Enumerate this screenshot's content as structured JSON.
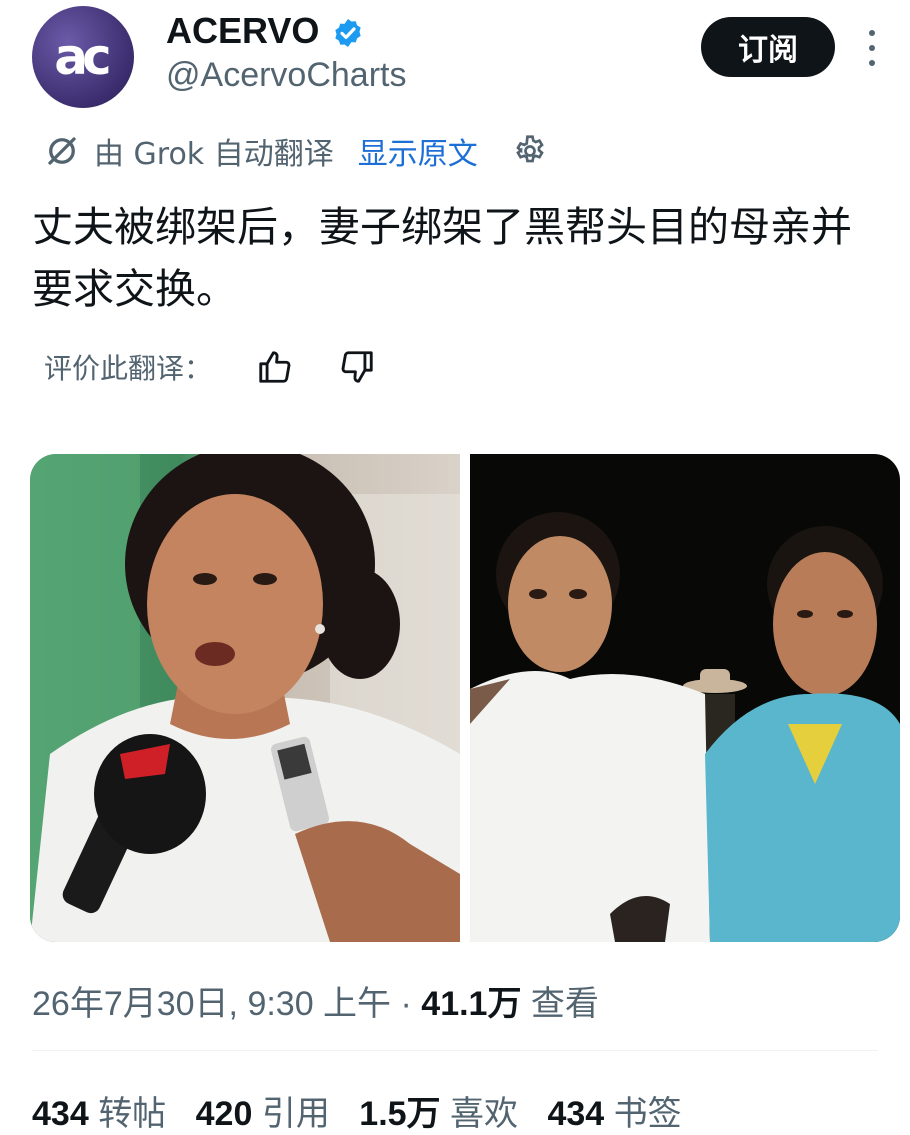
{
  "account": {
    "avatar_text": "ac",
    "name": "ACERVO",
    "handle": "@AcervoCharts",
    "subscribe_label": "订阅"
  },
  "translation": {
    "label": "由 Grok 自动翻译",
    "show_original": "显示原文"
  },
  "tweet": {
    "text": "丈夫被绑架后，妻子绑架了黑帮头目的母亲并要求交换。"
  },
  "rating": {
    "label": "评价此翻译："
  },
  "meta": {
    "datetime": "26年7月30日, 9:30 上午 · ",
    "views": "41.1万",
    "views_label": " 查看"
  },
  "stats": [
    {
      "count": "434",
      "label": "转帖"
    },
    {
      "count": "420",
      "label": "引用"
    },
    {
      "count": "1.5万",
      "label": "喜欢"
    },
    {
      "count": "434",
      "label": "书签"
    }
  ],
  "colors": {
    "accent": "#1d6fd6",
    "verified": "#1d9bf0",
    "secondary_text": "#536471",
    "primary_text": "#0f1419"
  }
}
